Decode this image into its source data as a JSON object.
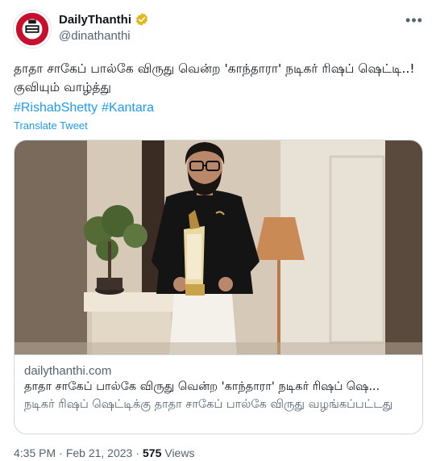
{
  "account": {
    "display_name": "DailyThanthi",
    "handle": "@dinathanthi",
    "avatar_icon": "dailythanthi-logo",
    "verified_icon": "verified-badge-icon",
    "verified_color": "#e2b719"
  },
  "tweet": {
    "text": "தாதா சாகேப் பால்கே விருது வென்ற 'காந்தாரா' நடிகர் ரிஷப் ஷெட்டி..! குவியும் வாழ்த்து",
    "hashtags": [
      "#RishabShetty",
      "#Kantara"
    ],
    "translate_label": "Translate Tweet"
  },
  "card": {
    "domain": "dailythanthi.com",
    "title": "தாதா சாகேப் பால்கே விருது வென்ற 'காந்தாரா' நடிகர் ரிஷப் ஷெ...",
    "description": "நடிகர் ரிஷப் ஷெட்டிக்கு தாதா சாகேப் பால்கே விருது வழங்கப்பட்டது"
  },
  "meta": {
    "time": "4:35 PM",
    "separator": "·",
    "date": "Feb 21, 2023",
    "views_count": "575",
    "views_label": "Views"
  },
  "colors": {
    "link": "#1d9bf0",
    "secondary_text": "#536471",
    "primary_text": "#0f1419",
    "border": "#cfd9de"
  }
}
